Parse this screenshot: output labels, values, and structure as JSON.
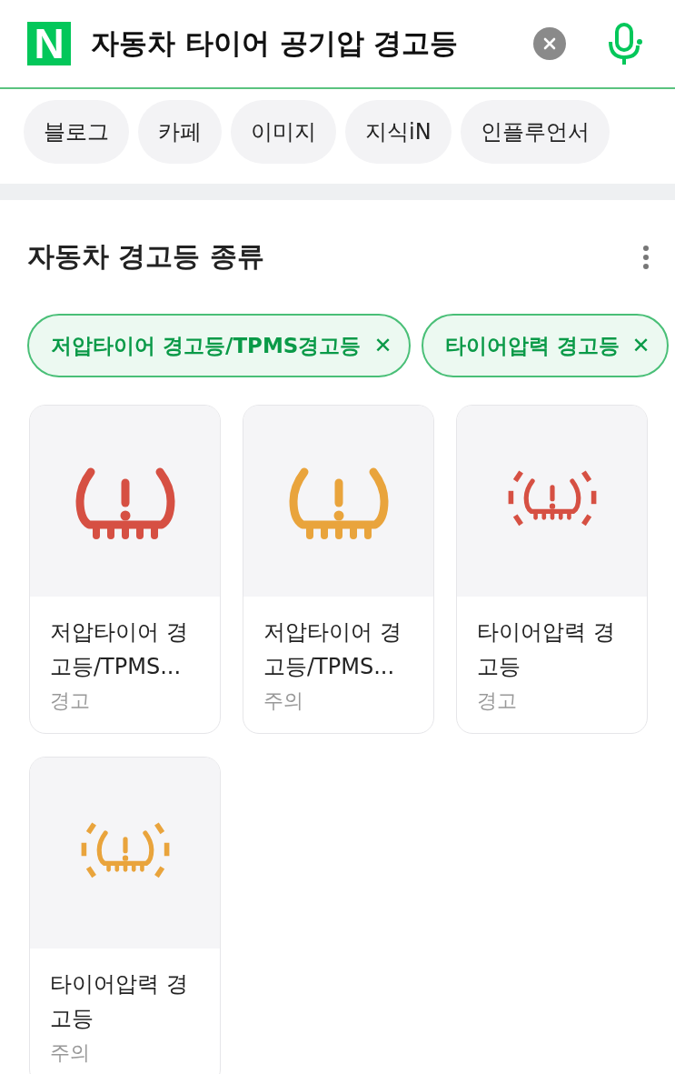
{
  "search": {
    "logo": "N",
    "query": "자동차 타이어 공기압 경고등"
  },
  "tabs": [
    {
      "label": "블로그",
      "selected": false
    },
    {
      "label": "카페",
      "selected": false
    },
    {
      "label": "이미지",
      "selected": false
    },
    {
      "label": "지식iN",
      "selected": false
    },
    {
      "label": "인플루언서",
      "selected": false
    }
  ],
  "section": {
    "title": "자동차 경고등 종류",
    "filters": [
      {
        "label": "저압타이어 경고등/TPMS경고등",
        "selected": true,
        "close": "✕"
      },
      {
        "label": "타이어압력 경고등",
        "selected": true,
        "close": "✕"
      }
    ],
    "cards": [
      {
        "kind": "tpms",
        "color": "#d65043",
        "title": "저압타이어 경고등/TPMS...",
        "level_text": "경고"
      },
      {
        "kind": "tpms",
        "color": "#e9a43c",
        "title": "저압타이어 경고등/TPMS...",
        "level_text": "주의"
      },
      {
        "kind": "pressure",
        "color": "#d65043",
        "title": "타이어압력 경고등",
        "level_text": "경고"
      },
      {
        "kind": "pressure",
        "color": "#e9a43c",
        "title": "타이어압력 경고등",
        "level_text": "주의"
      }
    ]
  }
}
